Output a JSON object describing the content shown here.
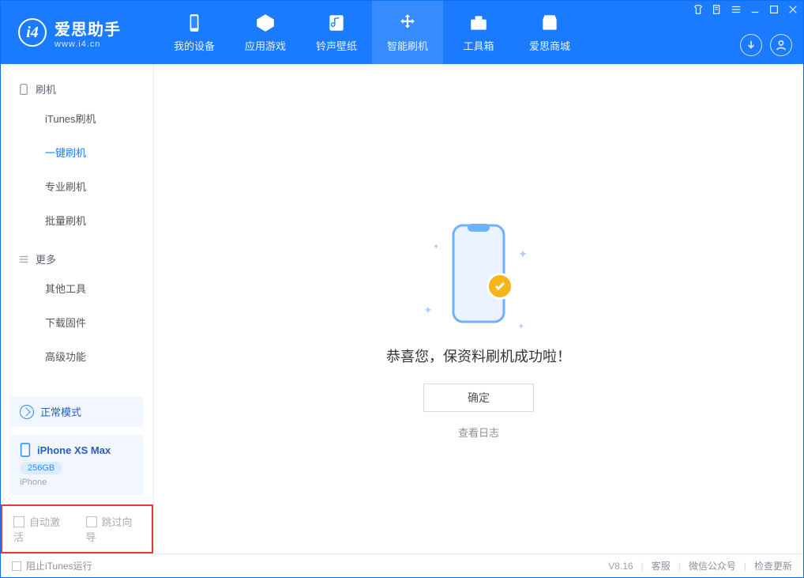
{
  "app": {
    "name": "爱思助手",
    "url": "www.i4.cn"
  },
  "nav": [
    {
      "label": "我的设备"
    },
    {
      "label": "应用游戏"
    },
    {
      "label": "铃声壁纸"
    },
    {
      "label": "智能刷机"
    },
    {
      "label": "工具箱"
    },
    {
      "label": "爱思商城"
    }
  ],
  "sidebar": {
    "group1": "刷机",
    "items1": [
      "iTunes刷机",
      "一键刷机",
      "专业刷机",
      "批量刷机"
    ],
    "group2": "更多",
    "items2": [
      "其他工具",
      "下载固件",
      "高级功能"
    ]
  },
  "status": {
    "mode": "正常模式"
  },
  "device": {
    "name": "iPhone XS Max",
    "storage": "256GB",
    "type": "iPhone"
  },
  "highlight": {
    "opt1": "自动激活",
    "opt2": "跳过向导"
  },
  "main": {
    "message": "恭喜您，保资料刷机成功啦！",
    "ok": "确定",
    "view_log": "查看日志"
  },
  "footer": {
    "block_itunes": "阻止iTunes运行",
    "version": "V8.16",
    "support": "客服",
    "wechat": "微信公众号",
    "update": "检查更新"
  }
}
